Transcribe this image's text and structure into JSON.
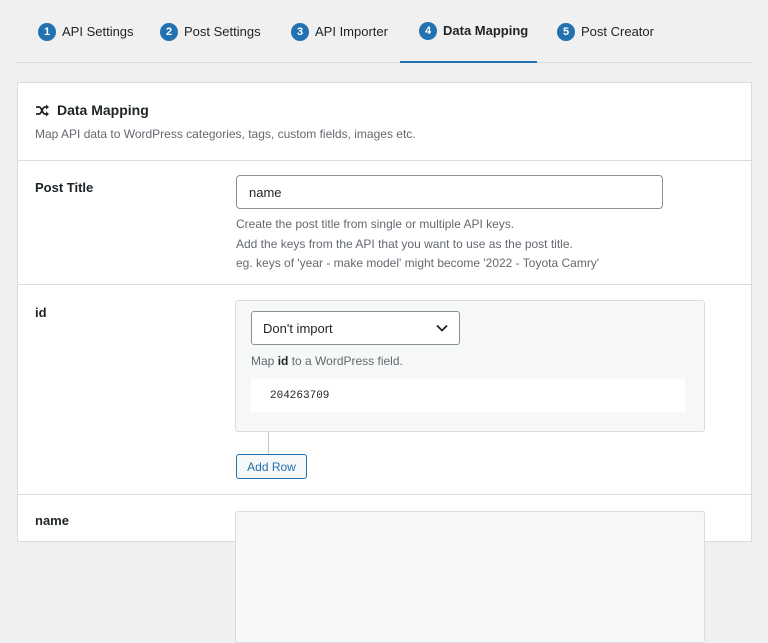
{
  "tabs": [
    {
      "num": "1",
      "label": "API Settings"
    },
    {
      "num": "2",
      "label": "Post Settings"
    },
    {
      "num": "3",
      "label": "API Importer"
    },
    {
      "num": "4",
      "label": "Data Mapping"
    },
    {
      "num": "5",
      "label": "Post Creator"
    }
  ],
  "active_tab": "Data Mapping",
  "section": {
    "title": "Data Mapping",
    "icon": "shuffle-icon",
    "description": "Map API data to WordPress categories, tags, custom fields, images etc."
  },
  "post_title": {
    "label": "Post Title",
    "value": "name",
    "help": [
      "Create the post title from single or multiple API keys.",
      "Add the keys from the API that you want to use as the post title.",
      "eg. keys of 'year - make model' might become '2022 - Toyota Camry'"
    ]
  },
  "fields": [
    {
      "key": "id",
      "select_value": "Don't import",
      "hint_prefix": "Map ",
      "hint_key": "id",
      "hint_suffix": " to a WordPress field.",
      "sample": "204263709",
      "add_row_label": "Add Row"
    },
    {
      "key": "name"
    }
  ],
  "colors": {
    "accent": "#2271b1",
    "border": "#dcdcde",
    "muted": "#646970"
  }
}
